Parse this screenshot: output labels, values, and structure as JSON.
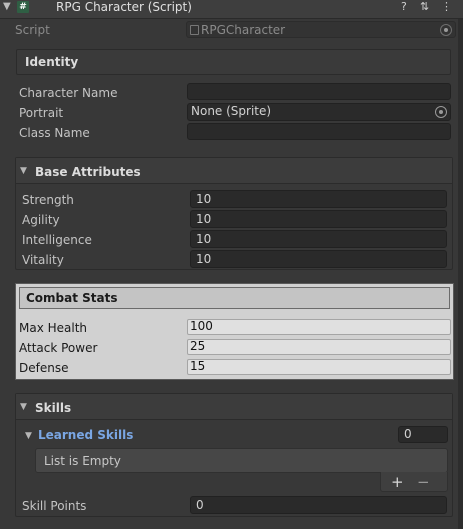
{
  "header": {
    "fold_icon": "triangle-down",
    "script_icon": "#",
    "title": "RPG Character (Script)",
    "help_icon": "?",
    "settings_icon": "⇅",
    "more_icon": "⋮"
  },
  "script": {
    "label": "Script",
    "value": "RPGCharacter"
  },
  "identity": {
    "title": "Identity",
    "character_name_label": "Character Name",
    "character_name_value": "",
    "portrait_label": "Portrait",
    "portrait_value": "None (Sprite)",
    "class_name_label": "Class Name",
    "class_name_value": ""
  },
  "base_attributes": {
    "title": "Base Attributes",
    "rows": [
      {
        "label": "Strength",
        "value": "10"
      },
      {
        "label": "Agility",
        "value": "10"
      },
      {
        "label": "Intelligence",
        "value": "10"
      },
      {
        "label": "Vitality",
        "value": "10"
      }
    ]
  },
  "combat_stats": {
    "title": "Combat Stats",
    "rows": [
      {
        "label": "Max Health",
        "value": "100"
      },
      {
        "label": "Attack Power",
        "value": "25"
      },
      {
        "label": "Defense",
        "value": "15"
      }
    ]
  },
  "skills": {
    "title": "Skills",
    "learned_label": "Learned Skills",
    "learned_count": "0",
    "empty_text": "List is Empty",
    "add_symbol": "+",
    "remove_symbol": "−",
    "skill_points_label": "Skill Points",
    "skill_points_value": "0"
  },
  "colors": {
    "background": "#383838",
    "field": "#2a2a2a",
    "light_section": "#d1d1d1",
    "link": "#7aa6e3"
  }
}
